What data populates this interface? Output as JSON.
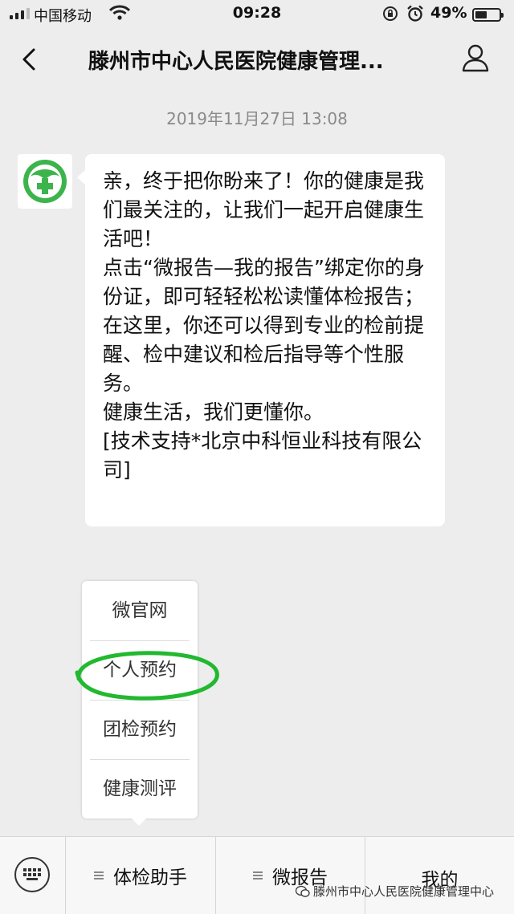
{
  "status_bar": {
    "carrier": "中国移动",
    "time": "09:28",
    "battery_percent": "49%",
    "battery_level": 0.49
  },
  "nav": {
    "title": "滕州市中心人民医院健康管理...",
    "back_icon": "chevron-left-icon",
    "profile_icon": "person-icon"
  },
  "chat": {
    "timestamp": "2019年11月27日 13:08",
    "message_lines": [
      "亲，终于把你盼来了！你的健康是我们最关注的，让我们一起开启健康生活吧！",
      "点击“微报告—我的报告”绑定你的身份证，即可轻轻松松读懂体检报告；",
      "在这里，你还可以得到专业的检前提醒、检中建议和检后指导等个性服务。",
      "健康生活，我们更懂你。",
      "[技术支持*北京中科恒业科技有限公司]"
    ]
  },
  "popup_menu": {
    "items": [
      "微官网",
      "个人预约",
      "团检预约",
      "健康测评"
    ],
    "highlighted": "个人预约",
    "highlight_color": "#22b82f"
  },
  "bottom_menu": {
    "tabs": [
      "体检助手",
      "微报告",
      "我的"
    ],
    "keyboard_icon": "keyboard-icon"
  },
  "watermark": {
    "text": "滕州市中心人民医院健康管理中心"
  },
  "colors": {
    "background": "#ededed",
    "bubble": "#ffffff",
    "logo_green": "#3cb44b"
  }
}
